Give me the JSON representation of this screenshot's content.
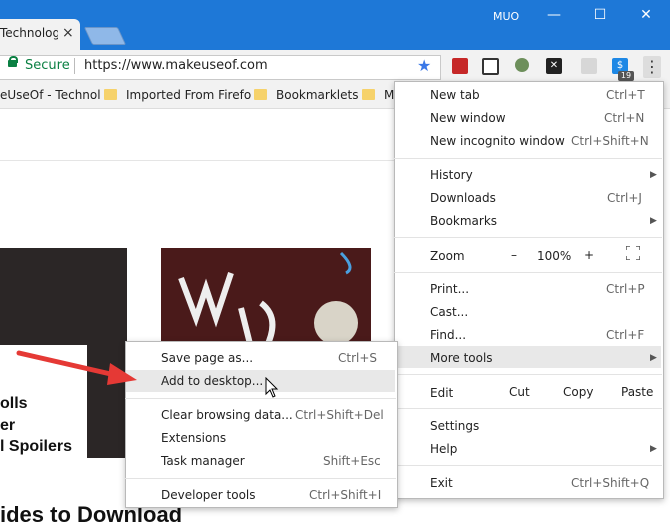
{
  "window": {
    "tab_title": "Technology",
    "tab_close": "×",
    "user": "MUO",
    "minimize": "—",
    "maximize": "☐",
    "close": "✕"
  },
  "omnibox": {
    "secure_label": "Secure",
    "url": "https://www.makeuseof.com"
  },
  "extensions": {
    "badge": "19"
  },
  "bookmarks": [
    {
      "label": "eUseOf - Technol"
    },
    {
      "label": "Imported From Firefo"
    },
    {
      "label": "Bookmarklets"
    },
    {
      "label": "M"
    }
  ],
  "page": {
    "headline_lines": [
      "olls",
      "er",
      "l Spoilers"
    ],
    "bottom_headline": "ides to Download"
  },
  "main_menu": {
    "items": [
      {
        "label": "New tab",
        "shortcut": "Ctrl+T"
      },
      {
        "label": "New window",
        "shortcut": "Ctrl+N"
      },
      {
        "label": "New incognito window",
        "shortcut": "Ctrl+Shift+N"
      },
      {
        "label": "History",
        "shortcut": ""
      },
      {
        "label": "Downloads",
        "shortcut": "Ctrl+J"
      },
      {
        "label": "Bookmarks",
        "shortcut": ""
      },
      {
        "label": "Print...",
        "shortcut": "Ctrl+P"
      },
      {
        "label": "Cast...",
        "shortcut": ""
      },
      {
        "label": "Find...",
        "shortcut": "Ctrl+F"
      },
      {
        "label": "More tools",
        "shortcut": ""
      },
      {
        "label": "Settings",
        "shortcut": ""
      },
      {
        "label": "Help",
        "shortcut": ""
      },
      {
        "label": "Exit",
        "shortcut": "Ctrl+Shift+Q"
      }
    ],
    "zoom": {
      "label": "Zoom",
      "minus": "–",
      "value": "100%",
      "plus": "+"
    },
    "edit": {
      "label": "Edit",
      "cut": "Cut",
      "copy": "Copy",
      "paste": "Paste"
    }
  },
  "sub_menu": {
    "items": [
      {
        "label": "Save page as...",
        "shortcut": "Ctrl+S"
      },
      {
        "label": "Add to desktop...",
        "shortcut": ""
      },
      {
        "label": "Clear browsing data...",
        "shortcut": "Ctrl+Shift+Del"
      },
      {
        "label": "Extensions",
        "shortcut": ""
      },
      {
        "label": "Task manager",
        "shortcut": "Shift+Esc"
      },
      {
        "label": "Developer tools",
        "shortcut": "Ctrl+Shift+I"
      }
    ]
  },
  "colors": {
    "titlebar": "#1e78d7",
    "secure": "#0b8043",
    "star": "#3b78e7",
    "arrow": "#e53935"
  }
}
